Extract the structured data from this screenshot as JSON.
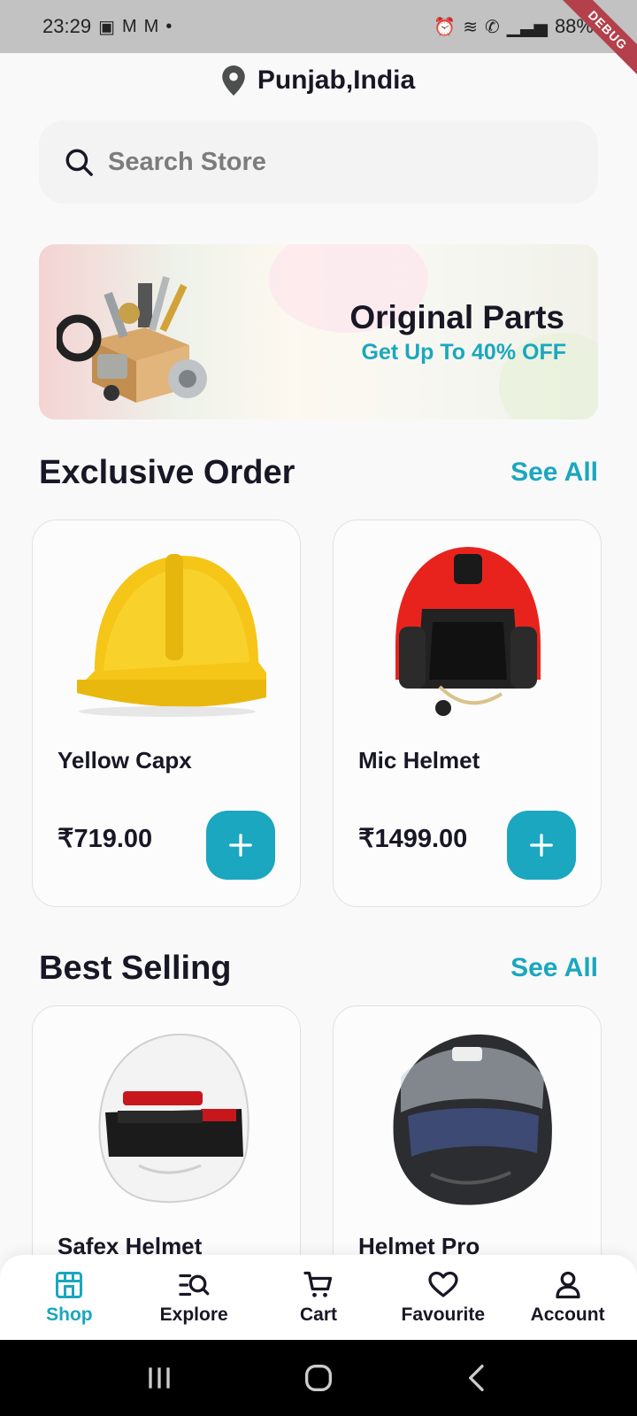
{
  "status_bar": {
    "time": "23:29",
    "battery": "88%",
    "debug_label": "DEBUG"
  },
  "location": {
    "text": "Punjab,India"
  },
  "search": {
    "placeholder": "Search Store"
  },
  "banner": {
    "title": "Original Parts",
    "subtitle": "Get Up To 40%  OFF"
  },
  "exclusive": {
    "title": "Exclusive Order",
    "see_all": "See All",
    "products": [
      {
        "name": "Yellow Capx",
        "price": "₹719.00",
        "icon": "yellow-hardhat"
      },
      {
        "name": "Mic Helmet",
        "price": "₹1499.00",
        "icon": "red-mic-helmet"
      }
    ]
  },
  "best_selling": {
    "title": "Best Selling",
    "see_all": "See All",
    "products": [
      {
        "name": "Safex Helmet",
        "icon": "white-racing-helmet"
      },
      {
        "name": "Helmet Pro",
        "icon": "black-fullface-helmet"
      }
    ]
  },
  "bottom_nav": {
    "items": [
      {
        "label": "Shop",
        "icon": "shop-icon",
        "active": true
      },
      {
        "label": "Explore",
        "icon": "explore-icon",
        "active": false
      },
      {
        "label": "Cart",
        "icon": "cart-icon",
        "active": false
      },
      {
        "label": "Favourite",
        "icon": "heart-icon",
        "active": false
      },
      {
        "label": "Account",
        "icon": "account-icon",
        "active": false
      }
    ]
  },
  "colors": {
    "accent": "#1aa7bf",
    "text": "#181725",
    "muted": "#7c7c7c"
  }
}
